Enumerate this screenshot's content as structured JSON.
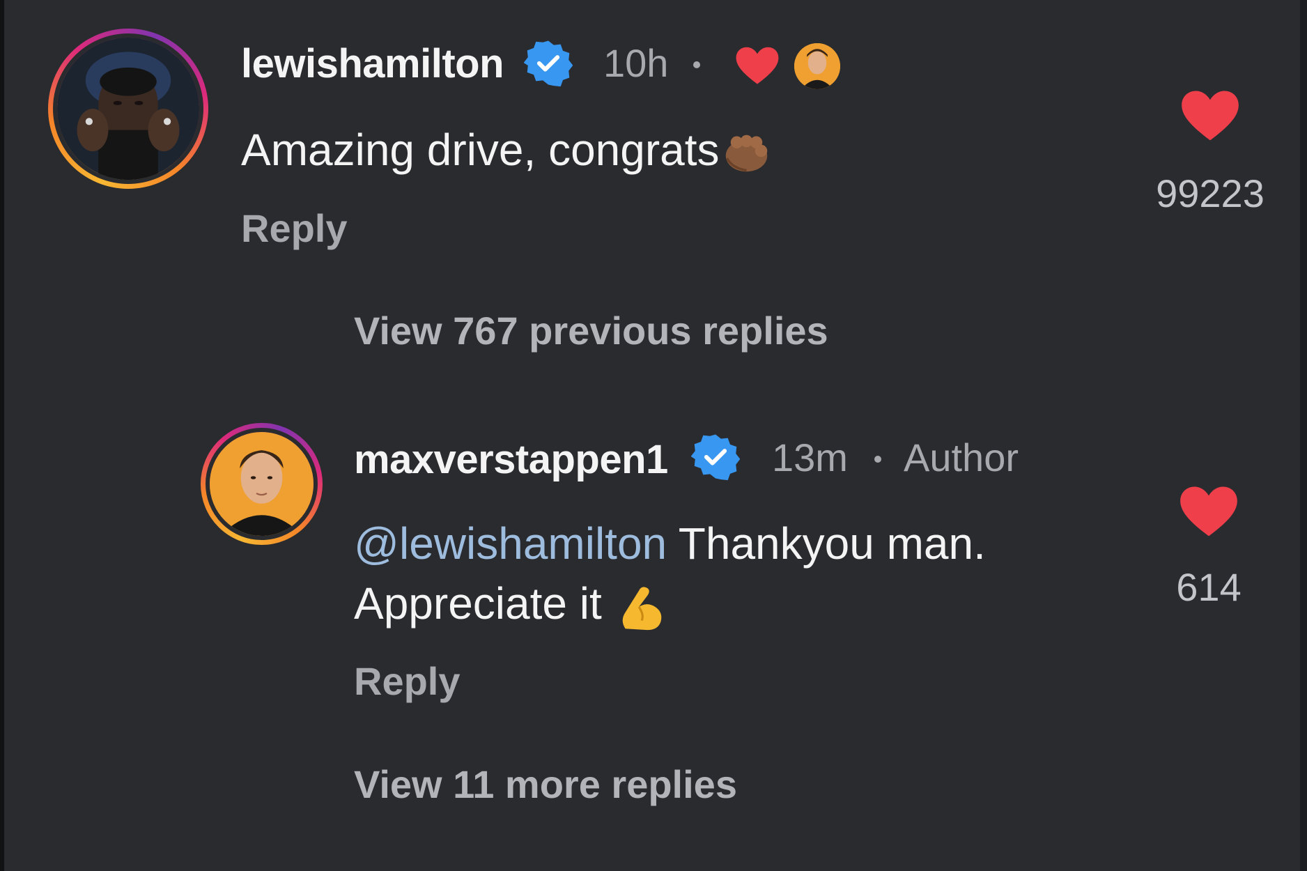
{
  "comments": [
    {
      "username": "lewishamilton",
      "time": "10h",
      "text": "Amazing drive, congrats",
      "emoji": "fist-bump",
      "reply_label": "Reply",
      "likes": "99223",
      "liked_by_author": true
    }
  ],
  "view_previous": "View 767 previous replies",
  "replies": [
    {
      "username": "maxverstappen1",
      "time": "13m",
      "author_badge": "Author",
      "mention": "@lewishamilton",
      "text_line1": " Thankyou man.",
      "text_line2": "Appreciate it",
      "emoji": "flexed-biceps",
      "reply_label": "Reply",
      "likes": "614"
    }
  ],
  "view_more": "View 11 more replies",
  "colors": {
    "background": "#2a2b2f",
    "heart": "#ee3f4a",
    "verified": "#3897f0",
    "mention": "#9ebcdd",
    "secondary_text": "#a7a9ae"
  }
}
